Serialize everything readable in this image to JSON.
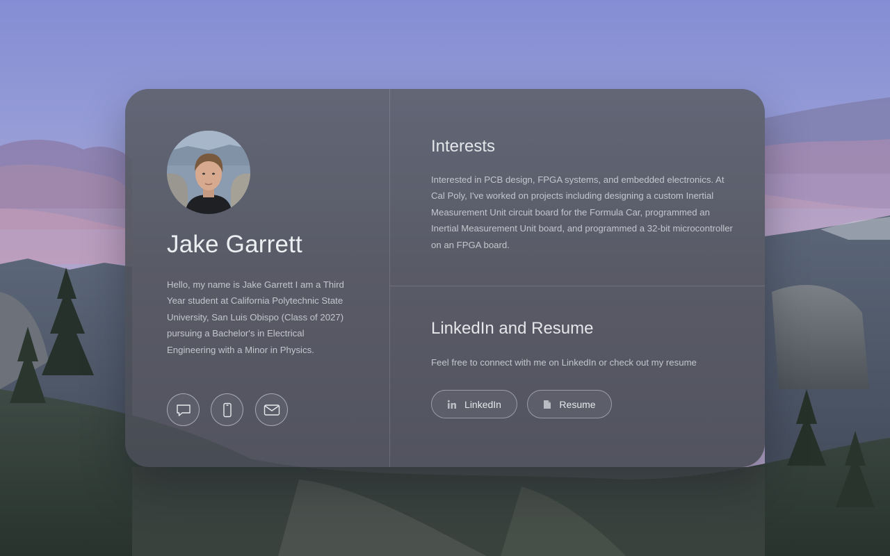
{
  "profile": {
    "name": "Jake Garrett",
    "bio": "Hello, my name is Jake Garrett I am a Third Year student at California Polytechnic State University, San Luis Obispo (Class of 2027) pursuing a Bachelor's in Electrical Engineering with a Minor in Physics."
  },
  "contact_icons": [
    {
      "icon": "chat-bubble-icon"
    },
    {
      "icon": "phone-icon"
    },
    {
      "icon": "mail-icon"
    }
  ],
  "interests": {
    "title": "Interests",
    "text": "Interested in PCB design, FPGA systems, and embedded electronics. At Cal Poly, I've worked on projects including designing a custom Inertial Measurement Unit circuit board for the Formula Car, programmed an Inertial Measurement Unit board, and programmed a 32-bit microcontroller on an FPGA board."
  },
  "links": {
    "title": "LinkedIn and Resume",
    "text": "Feel free to connect with me on LinkedIn or check out my resume",
    "linkedin_label": "LinkedIn",
    "linkedin_icon": "linkedin-icon",
    "resume_label": "Resume",
    "resume_icon": "document-icon"
  },
  "colors": {
    "card_bg": "#5a5d66",
    "text_primary": "#eceef2",
    "text_secondary": "#c3c6cd",
    "sky_top": "#8c92d6",
    "sky_bottom": "#b6a6cc"
  }
}
